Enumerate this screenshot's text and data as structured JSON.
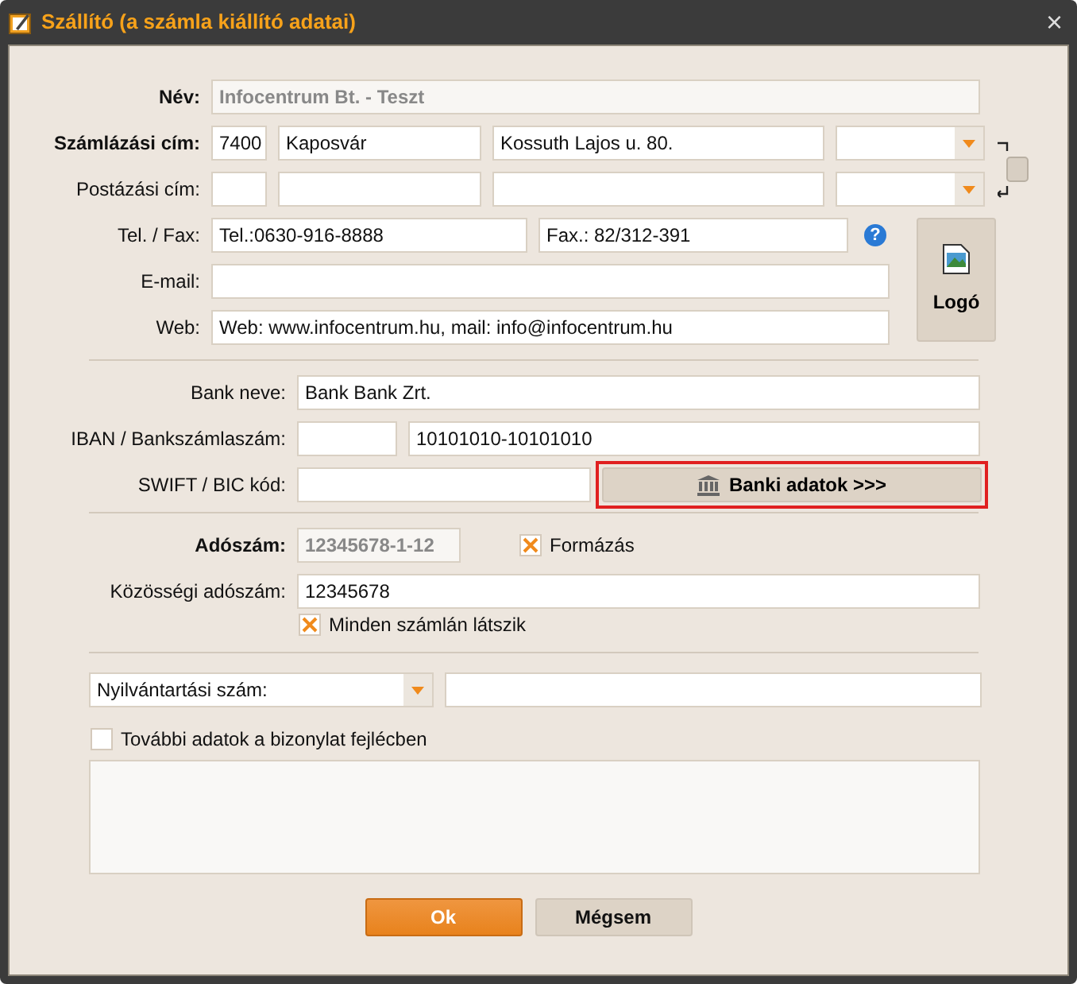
{
  "window": {
    "title": "Szállító (a számla kiállító adatai)",
    "close": "×"
  },
  "name": {
    "label": "Név:",
    "value": "Infocentrum Bt. - Teszt",
    "disabled": true
  },
  "billing_address": {
    "label": "Számlázási cím:",
    "zip": "7400",
    "city": "Kaposvár",
    "street": "Kossuth Lajos u. 80."
  },
  "postal_address": {
    "label": "Postázási cím:"
  },
  "phone_fax": {
    "label": "Tel. / Fax:",
    "phone": "Tel.:0630-916-8888",
    "fax": "Fax.: 82/312-391",
    "help": "?"
  },
  "email": {
    "label": "E-mail:"
  },
  "web": {
    "label": "Web:",
    "value": "Web: www.infocentrum.hu, mail: info@infocentrum.hu"
  },
  "logo_button": {
    "label": "Logó"
  },
  "bank_name": {
    "label": "Bank neve:",
    "value": "Bank Bank Zrt."
  },
  "iban": {
    "label": "IBAN / Bankszámlaszám:",
    "value": "10101010-10101010"
  },
  "swift": {
    "label": "SWIFT / BIC kód:"
  },
  "bank_button": {
    "label": "Banki adatok >>>",
    "highlighted": true
  },
  "tax_number": {
    "label": "Adószám:",
    "value": "12345678-1-12",
    "disabled": true,
    "format": {
      "label": "Formázás",
      "checked": true
    }
  },
  "eu_tax_number": {
    "label": "Közösségi adószám:",
    "value": "12345678"
  },
  "show_on_invoices": {
    "label": "Minden számlán látszik",
    "checked": true
  },
  "registry": {
    "select": "Nyilvántartási szám:"
  },
  "extra_header": {
    "label": "További adatok a bizonylat fejlécben",
    "checked": false
  },
  "buttons": [
    {
      "label": "Ok",
      "kind": "primary"
    },
    {
      "label": "Mégsem",
      "kind": "secondary"
    }
  ]
}
